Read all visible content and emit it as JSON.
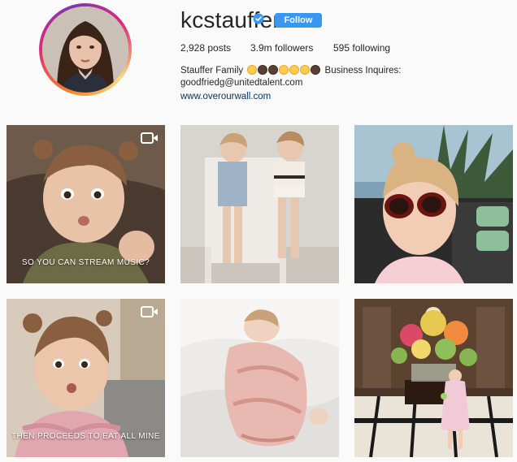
{
  "profile": {
    "username": "kcstauffer",
    "verified_icon": "verified-badge-icon",
    "follow_label": "Follow",
    "stats": {
      "posts": "2,928 posts",
      "followers": "3.9m followers",
      "following": "595 following"
    },
    "bio": {
      "line1_prefix": "Stauffer Family",
      "line1_suffix": "Business Inquires:",
      "line2": "goodfriedg@unitedtalent.com",
      "website": "www.overourwall.com"
    }
  },
  "posts": [
    {
      "caption": "SO YOU CAN STREAM MUSIC?",
      "video": true
    },
    {
      "caption": "",
      "video": false
    },
    {
      "caption": "",
      "video": false
    },
    {
      "caption": "THEN PROCEEDS TO EAT ALL MINE",
      "video": true
    },
    {
      "caption": "",
      "video": false
    },
    {
      "caption": "",
      "video": false
    }
  ],
  "colors": {
    "accent": "#3897f0",
    "link": "#003569",
    "background": "#fafafa"
  }
}
